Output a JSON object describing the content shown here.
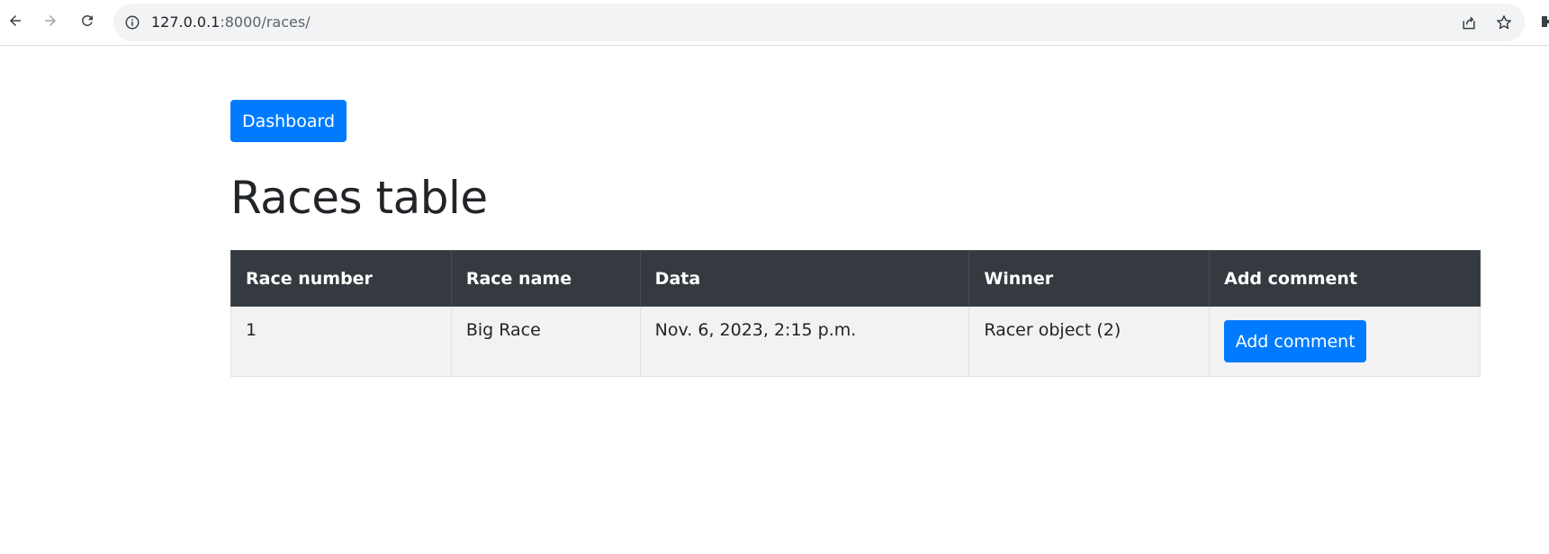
{
  "browser": {
    "url_host": "127.0.0.1",
    "url_path": ":8000/races/"
  },
  "page": {
    "dashboard_label": "Dashboard",
    "title": "Races table"
  },
  "table": {
    "headers": [
      "Race number",
      "Race name",
      "Data",
      "Winner",
      "Add comment"
    ],
    "rows": [
      {
        "race_number": "1",
        "race_name": "Big Race",
        "data": "Nov. 6, 2023, 2:15 p.m.",
        "winner": "Racer object (2)",
        "action_label": "Add comment"
      }
    ]
  },
  "colors": {
    "primary": "#007bff",
    "table_header_bg": "#343a40",
    "row_bg": "#f2f2f2"
  },
  "icons": [
    "back-arrow-icon",
    "forward-arrow-icon",
    "reload-icon",
    "info-icon",
    "share-icon",
    "star-icon",
    "extensions-icon"
  ]
}
